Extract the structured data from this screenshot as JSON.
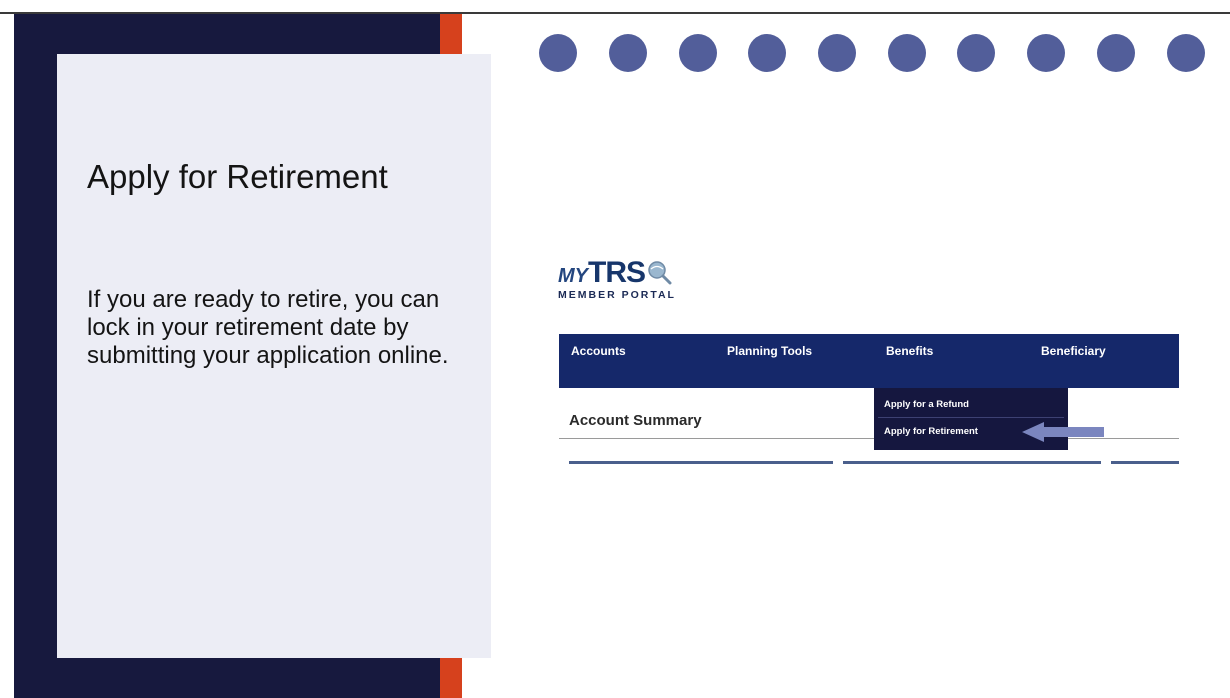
{
  "slide": {
    "title": "Apply for Retirement",
    "body": "If you are ready to retire, you can lock in your retirement date by submitting your application online."
  },
  "portal": {
    "logo_my": "MY",
    "logo_trs": "TRS",
    "logo_sub": "MEMBER PORTAL",
    "nav": [
      "Accounts",
      "Planning Tools",
      "Benefits",
      "Beneficiary"
    ],
    "dropdown": [
      "Apply for a Refund",
      "Apply for Retirement"
    ],
    "section_heading": "Account Summary"
  },
  "colors": {
    "navy": "#17193e",
    "orange": "#d6411d",
    "dot": "#525e9a",
    "nav_bar": "#15286a"
  },
  "icons": {
    "logo": "magnifier-globe-icon",
    "pointer": "arrow-left-icon"
  }
}
